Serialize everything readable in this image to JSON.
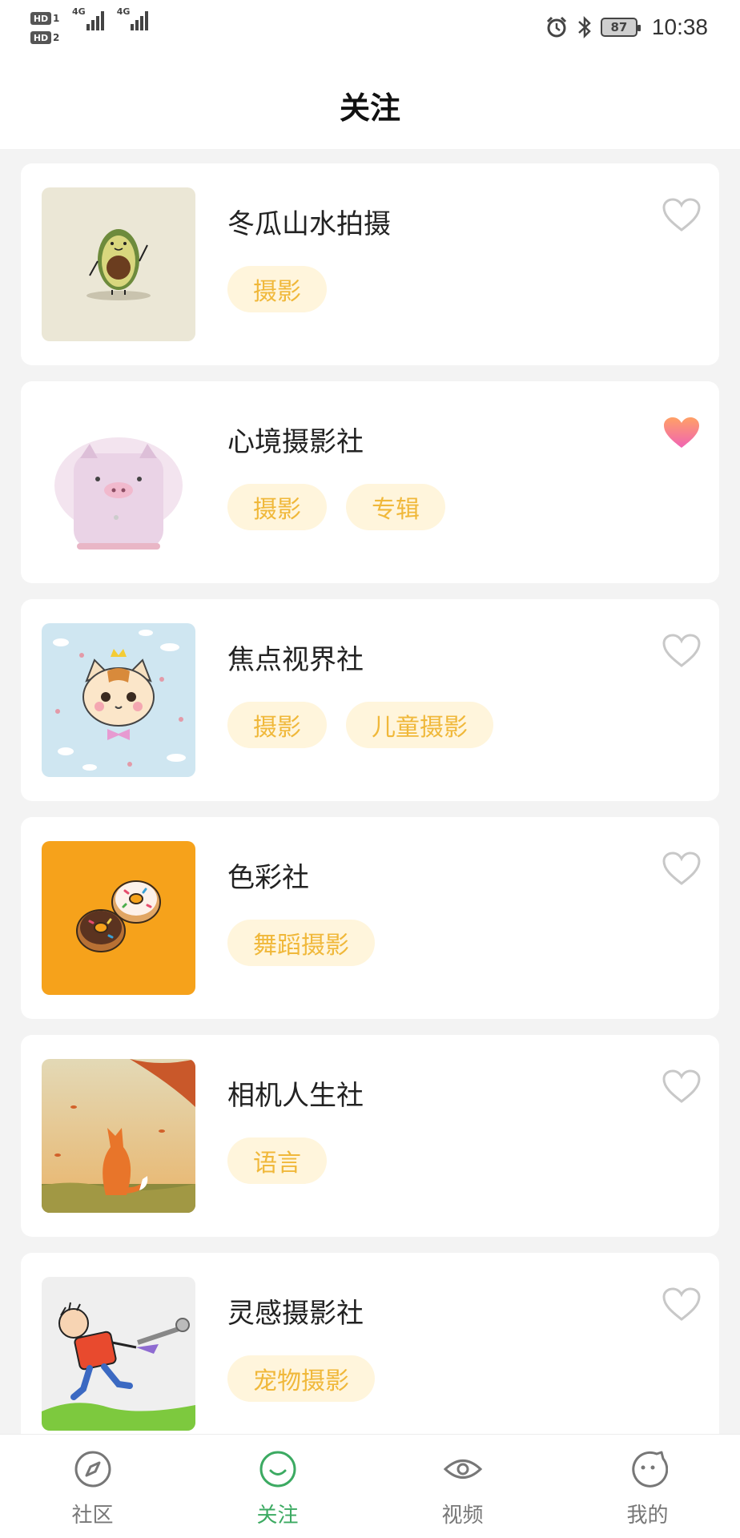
{
  "status_bar": {
    "sim1": "HD",
    "sim1_num": "1",
    "sim2": "HD",
    "sim2_num": "2",
    "net1": "4G",
    "net2": "4G",
    "battery": "87",
    "time": "10:38"
  },
  "header": {
    "title": "关注"
  },
  "items": [
    {
      "name": "冬瓜山水拍摄",
      "tags": [
        "摄影"
      ],
      "favorited": false,
      "thumb": "avocado"
    },
    {
      "name": "心境摄影社",
      "tags": [
        "摄影",
        "专辑"
      ],
      "favorited": true,
      "thumb": "pig"
    },
    {
      "name": "焦点视界社",
      "tags": [
        "摄影",
        "儿童摄影"
      ],
      "favorited": false,
      "thumb": "cat"
    },
    {
      "name": "色彩社",
      "tags": [
        "舞蹈摄影"
      ],
      "favorited": false,
      "thumb": "donuts"
    },
    {
      "name": "相机人生社",
      "tags": [
        "语言"
      ],
      "favorited": false,
      "thumb": "fox"
    },
    {
      "name": "灵感摄影社",
      "tags": [
        "宠物摄影"
      ],
      "favorited": false,
      "thumb": "boy"
    }
  ],
  "bottom_nav": [
    {
      "label": "社区",
      "icon": "compass-icon",
      "active": false
    },
    {
      "label": "关注",
      "icon": "smile-icon",
      "active": true
    },
    {
      "label": "视频",
      "icon": "eye-icon",
      "active": false
    },
    {
      "label": "我的",
      "icon": "face-icon",
      "active": false
    }
  ],
  "colors": {
    "active": "#3caa62",
    "tag_bg": "#fff5dc",
    "tag_text": "#f0b83a",
    "heart_on": "#f07aa0"
  }
}
